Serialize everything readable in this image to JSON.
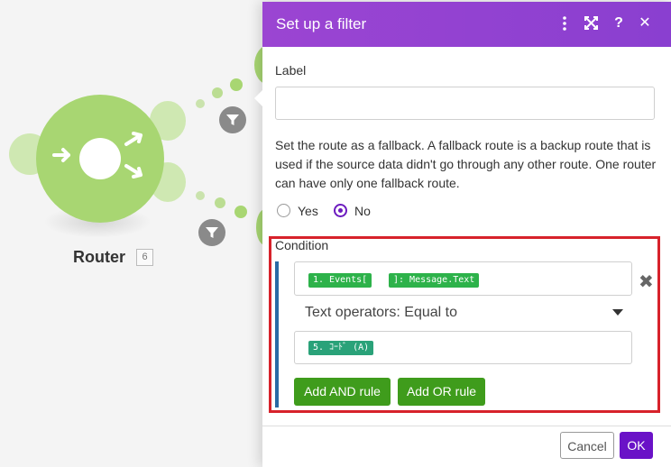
{
  "canvas": {
    "router": {
      "label": "Router",
      "badge": "6"
    }
  },
  "dialog": {
    "title": "Set up a filter",
    "header_icons": [
      "more-vertical-icon",
      "expand-icon",
      "help-icon",
      "close-icon"
    ],
    "help_glyph": "?",
    "close_glyph": "✕",
    "label_field": {
      "label": "Label",
      "value": ""
    },
    "fallback": {
      "text": "Set the route as a fallback. A fallback route is a backup route that is used if the source data didn't go through any other route. One router can have only one fallback route.",
      "options": [
        "Yes",
        "No"
      ],
      "selected": "No"
    },
    "condition": {
      "label": "Condition",
      "operand_a_chips": [
        "1. Events[",
        "]: Message.Text"
      ],
      "operator": "Text operators: Equal to",
      "operand_b_chips": [
        "5. ｺｰﾄﾞ (A)"
      ],
      "remove_glyph": "✖",
      "add_and_label": "Add AND rule",
      "add_or_label": "Add OR rule"
    },
    "footer": {
      "cancel_label": "Cancel",
      "ok_label": "OK"
    }
  },
  "colors": {
    "header": "#9b45d2",
    "module_green": "#a8d672",
    "chip_green": "#2db24a",
    "button_green": "#3f9c1c",
    "ok_purple": "#6a12c7",
    "highlight_red": "#d7222b"
  }
}
